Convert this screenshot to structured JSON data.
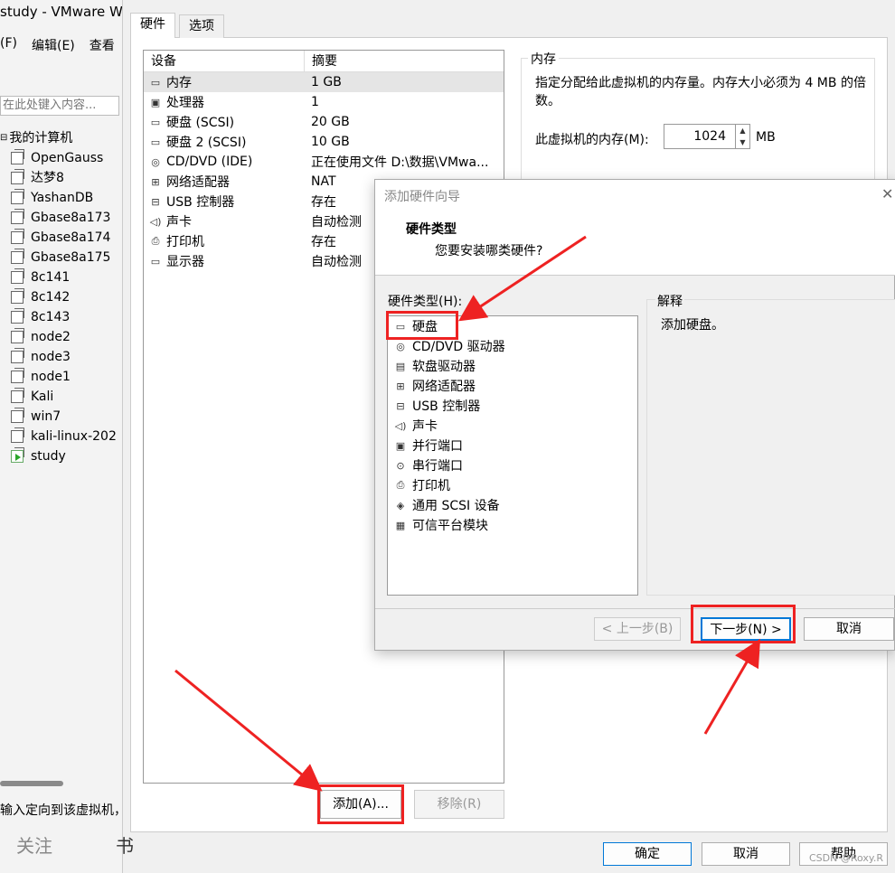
{
  "left_window": {
    "title": "study - VMware W",
    "menu": [
      "(F)",
      "编辑(E)",
      "查看"
    ],
    "search_placeholder": "在此处键入内容...",
    "tree_root": "我的计算机",
    "vms": [
      "OpenGauss",
      "达梦8",
      "YashanDB",
      "Gbase8a173",
      "Gbase8a174",
      "Gbase8a175",
      "8c141",
      "8c142",
      "8c143",
      "node2",
      "node3",
      "node1",
      "Kali",
      "win7",
      "kali-linux-202",
      "study"
    ],
    "status_text": "输入定向到该虚拟机，",
    "follow_label": "关注",
    "extra_label": "书"
  },
  "settings": {
    "tabs": [
      "硬件",
      "选项"
    ],
    "device_header": "设备",
    "summary_header": "摘要",
    "devices": [
      {
        "name": "内存",
        "summary": "1 GB",
        "icon": "memory-icon",
        "glyph": "▭"
      },
      {
        "name": "处理器",
        "summary": "1",
        "icon": "cpu-icon",
        "glyph": "▣"
      },
      {
        "name": "硬盘 (SCSI)",
        "summary": "20 GB",
        "icon": "hard-disk-icon",
        "glyph": "▭"
      },
      {
        "name": "硬盘 2 (SCSI)",
        "summary": "10 GB",
        "icon": "hard-disk-icon",
        "glyph": "▭"
      },
      {
        "name": "CD/DVD (IDE)",
        "summary": "正在使用文件 D:\\数据\\VMwa...",
        "icon": "cd-dvd-icon",
        "glyph": "◎"
      },
      {
        "name": "网络适配器",
        "summary": "NAT",
        "icon": "network-adapter-icon",
        "glyph": "⊞"
      },
      {
        "name": "USB 控制器",
        "summary": "存在",
        "icon": "usb-icon",
        "glyph": "⊟"
      },
      {
        "name": "声卡",
        "summary": "自动检测",
        "icon": "sound-card-icon",
        "glyph": "◁)"
      },
      {
        "name": "打印机",
        "summary": "存在",
        "icon": "printer-icon",
        "glyph": "⎙"
      },
      {
        "name": "显示器",
        "summary": "自动检测",
        "icon": "display-icon",
        "glyph": "▭"
      }
    ],
    "add_button": "添加(A)...",
    "remove_button": "移除(R)",
    "memory_group_title": "内存",
    "memory_desc": "指定分配给此虚拟机的内存量。内存大小必须为 4 MB 的倍数。",
    "memory_label": "此虚拟机的内存(M):",
    "memory_value": "1024",
    "memory_unit": "MB",
    "ok_button": "确定",
    "cancel_button": "取消",
    "help_button": "帮助",
    "watermark": "CSDN @Roxy.R"
  },
  "wizard": {
    "title": "添加硬件向导",
    "heading": "硬件类型",
    "subheading": "您要安装哪类硬件?",
    "hardware_label": "硬件类型(H):",
    "hardware_types": [
      {
        "name": "硬盘",
        "icon": "hard-disk-icon",
        "glyph": "▭"
      },
      {
        "name": "CD/DVD 驱动器",
        "icon": "cd-dvd-icon",
        "glyph": "◎"
      },
      {
        "name": "软盘驱动器",
        "icon": "floppy-icon",
        "glyph": "▤"
      },
      {
        "name": "网络适配器",
        "icon": "network-adapter-icon",
        "glyph": "⊞"
      },
      {
        "name": "USB 控制器",
        "icon": "usb-icon",
        "glyph": "⊟"
      },
      {
        "name": "声卡",
        "icon": "sound-card-icon",
        "glyph": "◁)"
      },
      {
        "name": "并行端口",
        "icon": "parallel-port-icon",
        "glyph": "▣"
      },
      {
        "name": "串行端口",
        "icon": "serial-port-icon",
        "glyph": "⊙"
      },
      {
        "name": "打印机",
        "icon": "printer-icon",
        "glyph": "⎙"
      },
      {
        "name": "通用 SCSI 设备",
        "icon": "scsi-device-icon",
        "glyph": "◈"
      },
      {
        "name": "可信平台模块",
        "icon": "tpm-icon",
        "glyph": "▦"
      }
    ],
    "explain_label": "解释",
    "explain_text": "添加硬盘。",
    "back_button": "< 上一步(B)",
    "next_button": "下一步(N) >",
    "cancel_button": "取消",
    "close_glyph": "✕"
  },
  "colors": {
    "annotation": "#ee2222",
    "accent": "#0078d7"
  }
}
